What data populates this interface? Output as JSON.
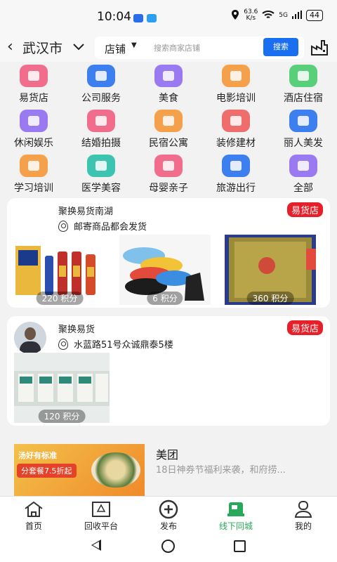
{
  "status_bar": {
    "time": "10:04",
    "speed": "63.6",
    "speed_unit": "K/s",
    "signal": "5G",
    "battery": "44"
  },
  "header": {
    "back_icon": "chevron-left-icon",
    "city": "武汉市",
    "search_type": "店铺",
    "search_placeholder": "搜索商家店铺",
    "search_button": "搜索"
  },
  "categories": [
    {
      "label": "易货店",
      "color": "#f06d8c"
    },
    {
      "label": "公司服务",
      "color": "#3d7ff0"
    },
    {
      "label": "美食",
      "color": "#9a7af0"
    },
    {
      "label": "电影培训",
      "color": "#f5a04a"
    },
    {
      "label": "酒店住宿",
      "color": "#58cf7a"
    },
    {
      "label": "休闲娱乐",
      "color": "#9a7af0"
    },
    {
      "label": "结婚拍摄",
      "color": "#f06d8c"
    },
    {
      "label": "民宿公寓",
      "color": "#f5a04a"
    },
    {
      "label": "装修建材",
      "color": "#f06d6d"
    },
    {
      "label": "丽人美发",
      "color": "#3d7ff0"
    },
    {
      "label": "学习培训",
      "color": "#f5a04a"
    },
    {
      "label": "医学美容",
      "color": "#3dc4b0"
    },
    {
      "label": "母婴亲子",
      "color": "#f06d8c"
    },
    {
      "label": "旅游出行",
      "color": "#3d7ff0"
    },
    {
      "label": "全部",
      "color": "#9a7af0"
    }
  ],
  "stores": [
    {
      "name": "聚换易货南湖",
      "badge": "易货店",
      "location": "邮寄商品都会发货",
      "products": [
        {
          "points": "220 积分"
        },
        {
          "points": "6 积分"
        },
        {
          "points": "360 积分"
        }
      ]
    },
    {
      "name": "聚换易货",
      "badge": "易货店",
      "location": "水蓝路51号众诚鼎泰5楼",
      "products": [
        {
          "points": "120 积分"
        }
      ]
    }
  ],
  "promo": {
    "title": "美团",
    "desc": "18日神券节福利来袭，和府捞...",
    "banner_text": "分套餐7.5折起",
    "top_text": "汤好有标准"
  },
  "tabs": [
    {
      "label": "首页",
      "icon": "home-icon"
    },
    {
      "label": "回收平台",
      "icon": "recycle-icon"
    },
    {
      "label": "发布",
      "icon": "plus-circle-icon"
    },
    {
      "label": "线下同城",
      "icon": "offline-store-icon",
      "active": true
    },
    {
      "label": "我的",
      "icon": "user-icon"
    }
  ],
  "accent_color": "#1a6ff0",
  "badge_color": "#e5202a",
  "active_tab_color": "#2aa85a"
}
